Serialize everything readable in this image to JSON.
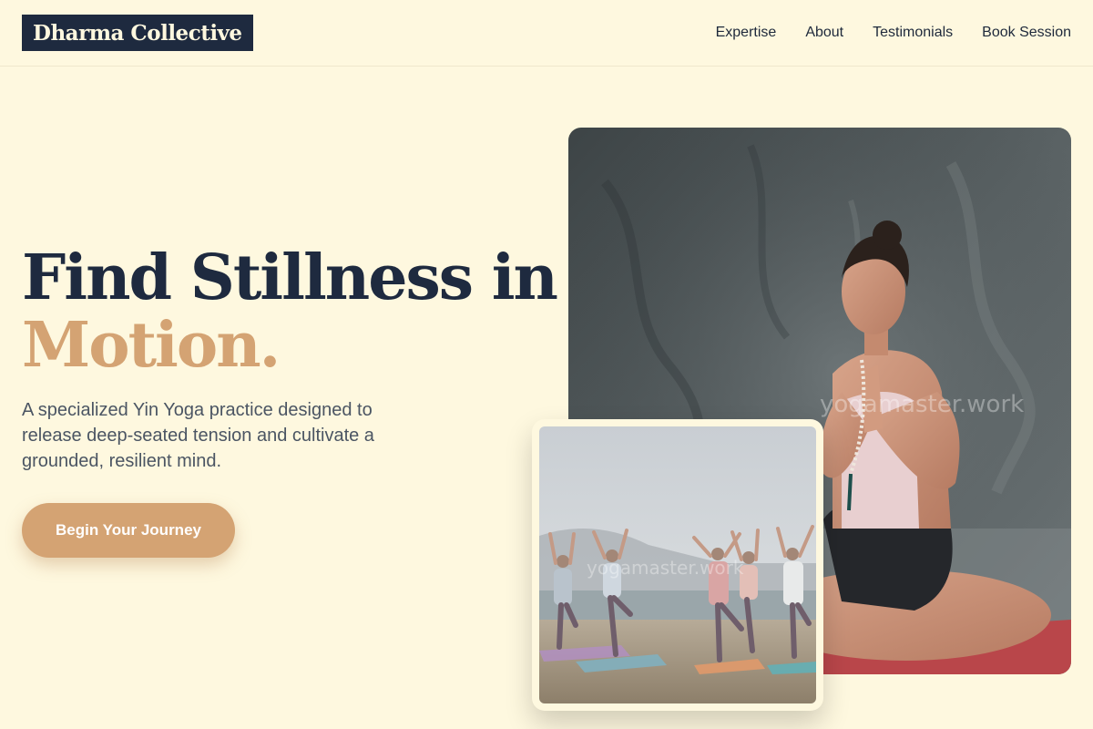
{
  "brand": {
    "name": "Dharma Collective"
  },
  "nav": {
    "items": [
      {
        "label": "Expertise"
      },
      {
        "label": "About"
      },
      {
        "label": "Testimonials"
      },
      {
        "label": "Book Session"
      }
    ]
  },
  "hero": {
    "title_line1": "Find Stillness in",
    "title_line2": "Motion.",
    "subtitle": "A specialized Yin Yoga practice designed to release deep-seated tension and cultivate a grounded, resilient mind.",
    "cta_label": "Begin Your Journey"
  },
  "images": {
    "main_alt": "Woman meditating in seated pose with prayer hands",
    "inset_alt": "Group practicing tree pose on the beach",
    "watermark": "yogamaster.work"
  },
  "colors": {
    "background": "#fef8df",
    "navy": "#1e2a3f",
    "accent": "#d4a373"
  }
}
